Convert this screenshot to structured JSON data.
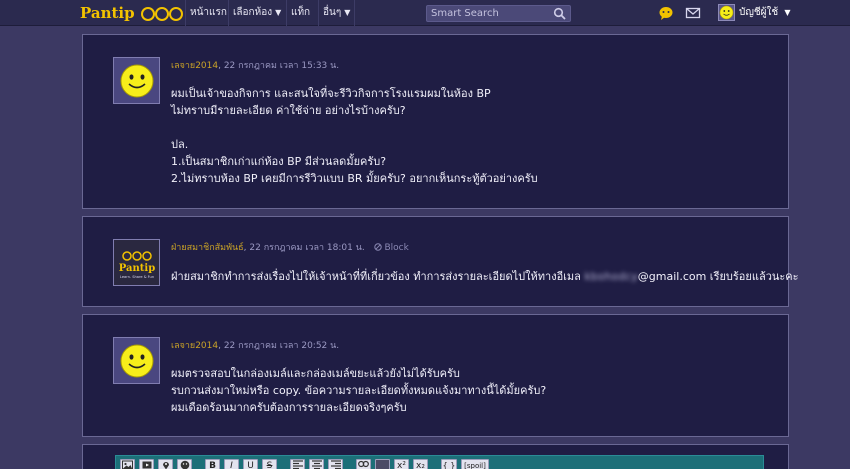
{
  "header": {
    "logo_text": "Pantip",
    "nav": [
      {
        "label": "หน้าแรก",
        "caret": ""
      },
      {
        "label": "เลือกห้อง",
        "caret": "▼"
      },
      {
        "label": "แท็ก",
        "caret": ""
      },
      {
        "label": "อื่นๆ",
        "caret": "▼"
      }
    ],
    "search_placeholder": "Smart Search",
    "user_label": "บัญชีผู้ใช้",
    "user_caret": "▼",
    "icons": [
      "search-icon",
      "chat-icon",
      "mail-icon",
      "smiley-avatar-icon"
    ],
    "brand_color": "#f2c200"
  },
  "posts": [
    {
      "author": "เลจาย2014",
      "date": ", 22 กรกฎาคม เวลา 15:33 น.",
      "avatar": "smiley-icon",
      "lines": [
        "ผมเป็นเจ้าของกิจการ และสนใจที่จะรีวิวกิจการโรงแรมผมในห้อง BP",
        "ไม่ทราบมีรายละเอียด ค่าใช้จ่าย อย่างไรบ้างครับ?",
        "",
        "ปล.",
        "1.เป็นสมาชิกเก่าแก่ห้อง BP มีส่วนลดมั้ยครับ?",
        "2.ไม่ทราบห้อง BP เคยมีการรีวิวแบบ BR มั้ยครับ? อยากเห็นกระทู้ตัวอย่างครับ"
      ]
    },
    {
      "author": "ฝ่ายสมาชิกสัมพันธ์",
      "date": ", 22 กรกฎาคม เวลา 18:01 น.",
      "block_label": "Block",
      "avatar": "pantip-logo-icon",
      "avatar_title": "Pantip",
      "avatar_subtitle": "Learn. Share & Fun",
      "line_before": "ฝ่ายสมาชิกทำการส่งเรื่องไปให้เจ้าหน้าที่ที่เกี่ยวข้อง ทำการส่งรายละเอียดไปให้ทางอีเมล ",
      "blurred": "kbohodcy",
      "line_after": "@gmail.com  เรียบร้อยแล้วนะคะ"
    },
    {
      "author": "เลจาย2014",
      "date": ", 22 กรกฎาคม เวลา 20:52 น.",
      "avatar": "smiley-icon",
      "lines": [
        "ผมตรวจสอบในกล่องเมล์และกล่องเมล์ขยะแล้วยังไม่ได้รับครับ",
        "รบกวนส่งมาใหม่หรือ copy. ข้อความรายละเอียดทั้งหมดแจ้งมาทางนี้ได้มั้ยครับ?",
        "ผมเดือดร้อนมากครับต้องการรายละเอียดจริงๆครับ"
      ]
    }
  ],
  "editor": {
    "tools": {
      "bold": "B",
      "italic": "I",
      "underline": "U",
      "strike": "S",
      "superscript": "x²",
      "subscript": "x₂",
      "code": "{ }",
      "spoil": "[spoil]"
    },
    "toolbar_color": "#1c6f78"
  }
}
